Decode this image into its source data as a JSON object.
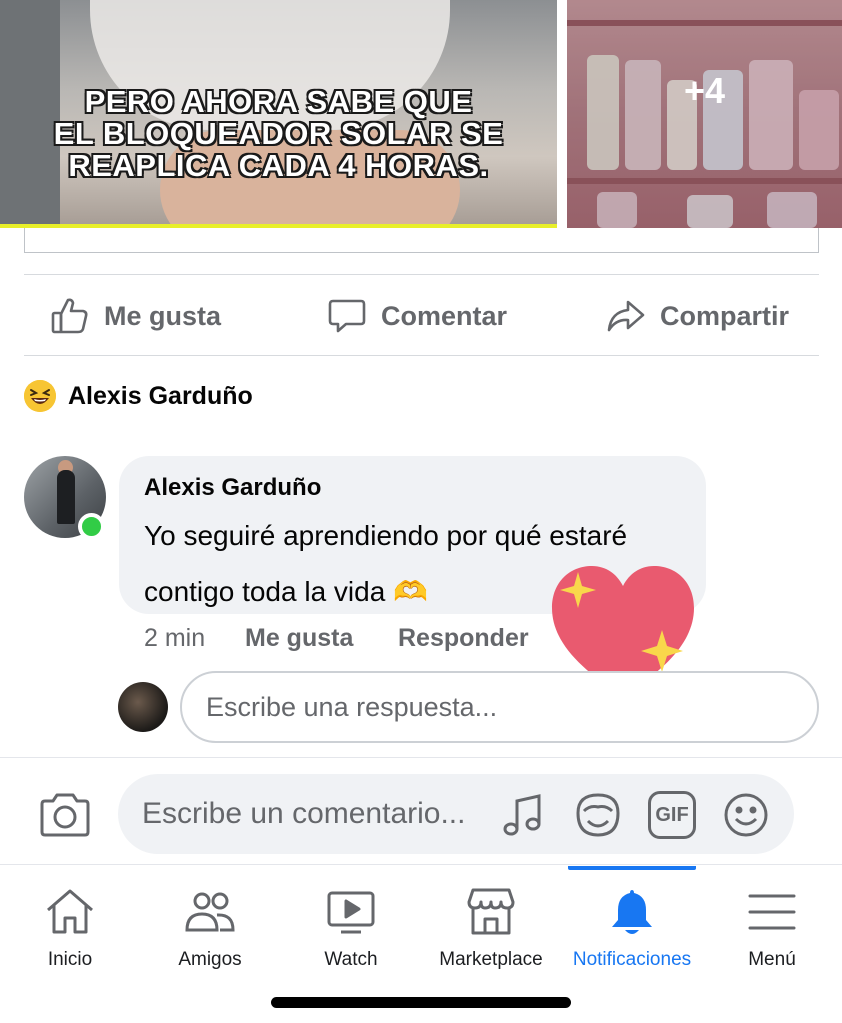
{
  "post": {
    "image_overlay_lines": [
      "PERO AHORA SABE QUE",
      "EL BLOQUEADOR SOLAR SE",
      "REAPLICA CADA 4 HORAS."
    ],
    "more_images": "+4"
  },
  "actions": {
    "like": "Me gusta",
    "comment": "Comentar",
    "share": "Compartir"
  },
  "reaction": {
    "emoji": "laughing-emoji",
    "name": "Alexis Garduño"
  },
  "comment": {
    "author": "Alexis Garduño",
    "text": "Yo seguiré aprendiendo por qué estaré contigo toda la vida 🫶",
    "time": "2 min",
    "like": "Me gusta",
    "reply": "Responder",
    "online": true
  },
  "reply_box": {
    "placeholder": "Escribe una respuesta..."
  },
  "composer": {
    "placeholder": "Escribe un comentario...",
    "icons": [
      "camera-icon",
      "music-icon",
      "avatar-sticker-icon",
      "gif-icon",
      "emoji-icon"
    ],
    "gif_label": "GIF"
  },
  "tabbar": {
    "tabs": [
      {
        "label": "Inicio",
        "icon": "home-icon"
      },
      {
        "label": "Amigos",
        "icon": "friends-icon"
      },
      {
        "label": "Watch",
        "icon": "watch-icon"
      },
      {
        "label": "Marketplace",
        "icon": "marketplace-icon"
      },
      {
        "label": "Notificaciones",
        "icon": "bell-icon"
      },
      {
        "label": "Menú",
        "icon": "menu-icon"
      }
    ],
    "active": "Notificaciones"
  },
  "colors": {
    "accent": "#1877f2",
    "secondary_text": "#65676b",
    "bubble_bg": "#f0f2f5",
    "online": "#31cc46",
    "heart": "#e95a6f",
    "sparkle": "#f9d74b"
  }
}
